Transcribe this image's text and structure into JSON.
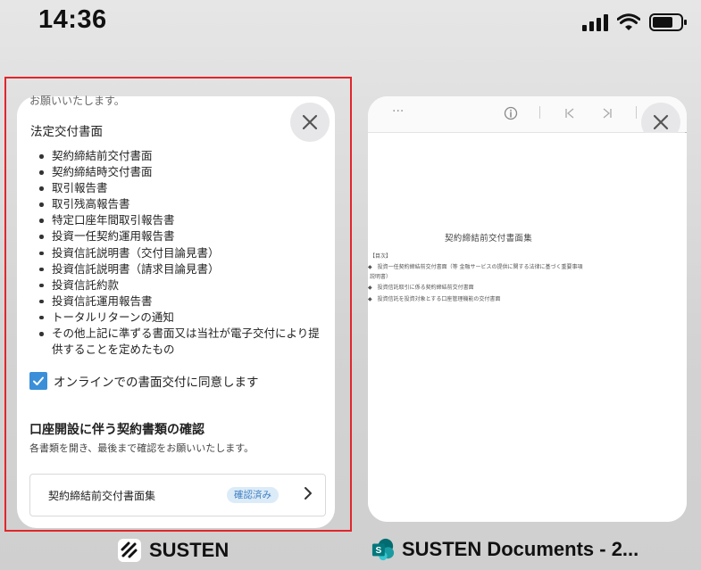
{
  "status_bar": {
    "time": "14:36"
  },
  "app1": {
    "name": "SUSTEN",
    "peek_text": "お願いいたします。",
    "section_title": "法定交付書面",
    "items": [
      "契約締結前交付書面",
      "契約締結時交付書面",
      "取引報告書",
      "取引残高報告書",
      "特定口座年間取引報告書",
      "投資一任契約運用報告書",
      "投資信託説明書（交付目論見書）",
      "投資信託説明書（請求目論見書）",
      "投資信託約款",
      "投資信託運用報告書",
      "トータルリターンの通知",
      "その他上記に準ずる書面又は当社が電子交付により提供することを定めたもの"
    ],
    "consent_label": "オンラインでの書面交付に同意します",
    "section2_title": "口座開設に伴う契約書類の確認",
    "section2_desc": "各書類を開き、最後まで確認をお願いいたします。",
    "document_row": {
      "label": "契約締結前交付書面集",
      "status": "確認済み"
    }
  },
  "app2": {
    "name": "SUSTEN Documents - 2...",
    "toolbar": {
      "more": "···"
    },
    "doc_title": "契約締結前交付書面集",
    "doc_lines": [
      "【目次】",
      "◆　投資一任契約締結前交付書面（等 金融サービスの提供に関する法律に基づく重要事項",
      "説明書）",
      "◆　投資信託取引に係る契約締結前交付書面",
      "◆　投資信託を投資対象とする口座管理機能の交付書面"
    ]
  }
}
